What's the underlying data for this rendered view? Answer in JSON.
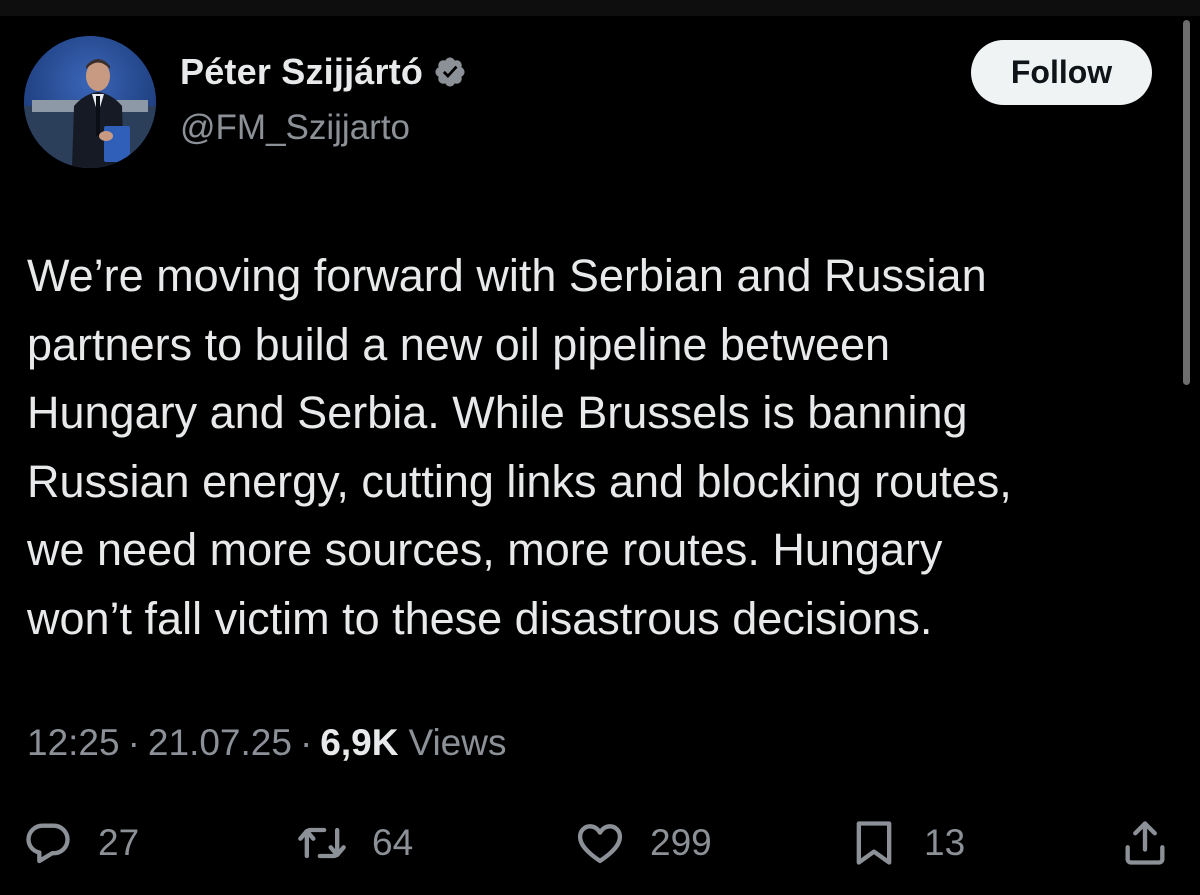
{
  "author": {
    "display_name": "Péter Szijjártó",
    "handle": "@FM_Szijjarto",
    "verified": true,
    "avatar_icon": "profile-photo"
  },
  "follow_label": "Follow",
  "tweet": {
    "lines": [
      "We’re moving forward with Serbian and Russian",
      "partners to build a new oil pipeline between",
      "Hungary and Serbia. While Brussels is banning",
      "Russian energy, cutting links and blocking routes,",
      "we need more sources, more routes. Hungary",
      "won’t fall victim to these disastrous decisions."
    ]
  },
  "meta": {
    "time": "12:25",
    "date": "21.07.25",
    "separator": "·",
    "views_count": "6,9K",
    "views_label": "Views"
  },
  "actions": {
    "replies": "27",
    "reposts": "64",
    "likes": "299",
    "bookmarks": "13"
  },
  "colors": {
    "background": "#000000",
    "text_primary": "#e7e9ea",
    "text_secondary": "#8b9197",
    "verified_badge": "#8b9197",
    "follow_bg": "#eff3f4",
    "follow_text": "#0f1419"
  }
}
